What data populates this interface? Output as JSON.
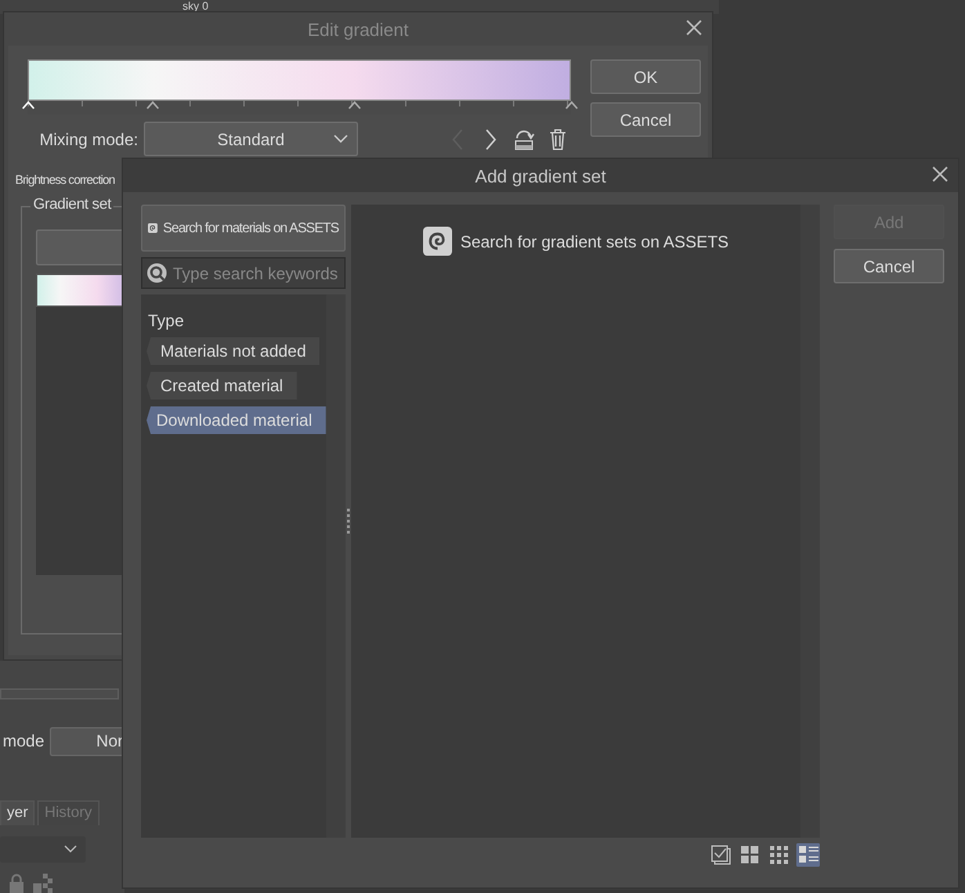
{
  "background_app": {
    "layer_name": "sky 0",
    "blend_mode": {
      "label": "mode",
      "value": "Nor"
    },
    "tabs": [
      {
        "label": "yer",
        "selected": true
      },
      {
        "label": "History",
        "selected": false
      }
    ]
  },
  "edit_gradient": {
    "title": "Edit gradient",
    "stops": [
      {
        "color": "#d2f1ea",
        "level": 0
      },
      {
        "color": "#f6f6f6",
        "level": 0.23
      },
      {
        "color": "#f5dbee",
        "level": 0.6
      },
      {
        "color": "#c0aee1",
        "level": 1
      }
    ],
    "buttons": [
      "OK",
      "Cancel"
    ],
    "mixing_mode": {
      "label": "Mixing mode:",
      "value": "Standard"
    },
    "navigation": {
      "previous_disabled": true,
      "next_disabled": false
    },
    "brightness_correction": "Brightness correction",
    "gradient_set": {
      "label": "Gradient set"
    }
  },
  "add_gradient_set": {
    "title": "Add gradient set",
    "assets_button": "Search for materials on ASSETS",
    "search": {
      "placeholder": "Type search keywords"
    },
    "type_heading": "Type",
    "types": [
      {
        "label": "Materials not added",
        "selected": false
      },
      {
        "label": "Created material",
        "selected": false
      },
      {
        "label": "Downloaded material",
        "selected": true
      }
    ],
    "assets_link": "Search for gradient sets on ASSETS",
    "buttons": [
      {
        "label": "Add",
        "disabled": true
      },
      {
        "label": "Cancel",
        "disabled": false
      }
    ],
    "view_modes": [
      {
        "kind": "check",
        "selected": false
      },
      {
        "kind": "large",
        "selected": false
      },
      {
        "kind": "small",
        "selected": false
      },
      {
        "kind": "list",
        "selected": true
      }
    ]
  }
}
